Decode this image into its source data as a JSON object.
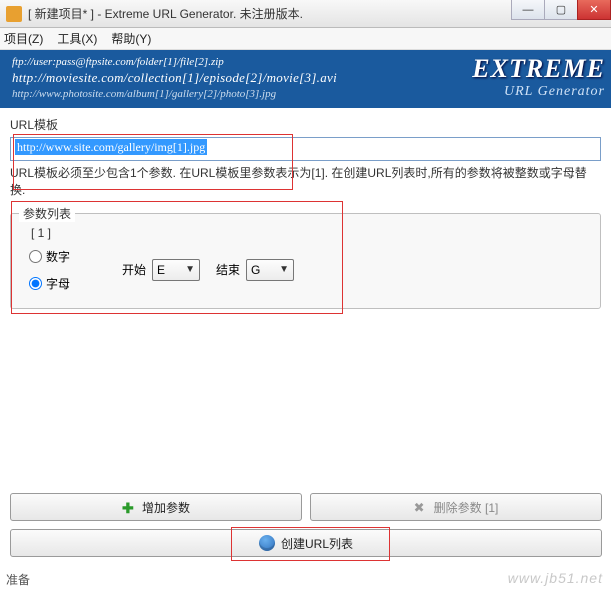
{
  "window": {
    "title": "[ 新建项目* ] - Extreme URL Generator. 未注册版本.",
    "min": "—",
    "max": "▢",
    "close": "✕"
  },
  "menu": {
    "project": "项目(Z)",
    "tools": "工具(X)",
    "help": "帮助(Y)"
  },
  "banner": {
    "ex1": "ftp://user:pass@ftpsite.com/folder[1]/file[2].zip",
    "ex2": "http://moviesite.com/collection[1]/episode[2]/movie[3].avi",
    "ex3": "http://www.photosite.com/album[1]/gallery[2]/photo[3].jpg",
    "brand1": "EXTREME",
    "brand2": "URL Generator"
  },
  "urltpl": {
    "label": "URL模板",
    "value": "http://www.site.com/gallery/img[1].jpg",
    "hint": "URL模板必须至少包含1个参数. 在URL模板里参数表示为[1]. 在创建URL列表时,所有的参数将被整数或字母替换."
  },
  "params": {
    "legend": "参数列表",
    "bracket": "[ 1 ]",
    "radio_number": "数字",
    "radio_letter": "字母",
    "start_label": "开始",
    "start_value": "E",
    "end_label": "结束",
    "end_value": "G"
  },
  "buttons": {
    "add": "增加参数",
    "del": "删除参数 [1]",
    "create": "创建URL列表"
  },
  "footer": "准备",
  "watermark": "www.jb51.net"
}
